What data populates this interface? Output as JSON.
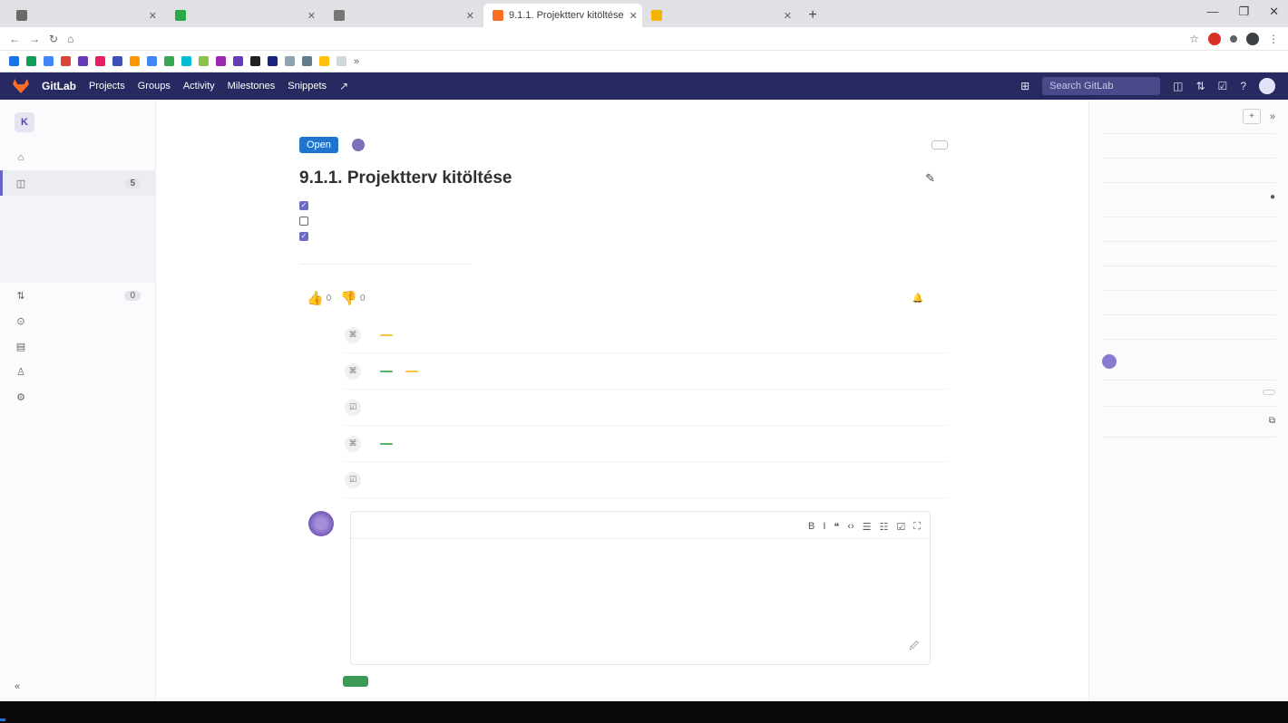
{
  "browser": {
    "tabs": [
      {
        "label": "",
        "color": "#6b6b6b"
      },
      {
        "label": "",
        "color": "#2ba84a"
      },
      {
        "label": "",
        "color": "#777777"
      },
      {
        "label": "9.1.1. Projektterv kitöltése",
        "color": "#fc6d26",
        "active": true
      },
      {
        "label": "",
        "color": "#f4b400"
      }
    ],
    "new_tab": "+",
    "url": "",
    "window_controls": [
      "—",
      "❐",
      "✕"
    ]
  },
  "gitlab_nav": {
    "brand": "GitLab",
    "items": [
      "Projects",
      "Groups",
      "Activity",
      "Milestones",
      "Snippets"
    ],
    "search_placeholder": "Search GitLab"
  },
  "sidebar": {
    "project_initial": "K",
    "project_name": "",
    "items": [
      {
        "icon": "home-icon",
        "glyph": "⌂",
        "label": ""
      },
      {
        "icon": "issues-icon",
        "glyph": "◫",
        "label": "",
        "active": true,
        "count": "5"
      },
      {
        "icon": "merge-request-icon",
        "glyph": "⇅",
        "label": "",
        "count": "0"
      },
      {
        "icon": "ci-icon",
        "glyph": "⊙",
        "label": ""
      },
      {
        "icon": "wiki-icon",
        "glyph": "▤",
        "label": ""
      },
      {
        "icon": "members-icon",
        "glyph": "♙",
        "label": ""
      },
      {
        "icon": "settings-icon",
        "glyph": "⚙",
        "label": ""
      }
    ],
    "sub_items": [
      "",
      "",
      "",
      ""
    ],
    "collapse_label": "",
    "collapse_glyph": "«"
  },
  "main": {
    "breadcrumb": "",
    "status": "Open",
    "opened_text": "",
    "author": "",
    "actions": {
      "close": "",
      "new": ""
    },
    "title": "9.1.1. Projektterv kitöltése",
    "tasks": [
      {
        "checked": true,
        "text": ""
      },
      {
        "checked": false,
        "text": ""
      },
      {
        "checked": true,
        "text": ""
      }
    ],
    "edited_text": "",
    "reactions": [
      {
        "glyph": "👍",
        "count": "0"
      },
      {
        "glyph": "👎",
        "count": "0"
      }
    ],
    "subscribe": "",
    "activity": [
      {
        "user": "",
        "pre": "",
        "label1": "",
        "label1_color": "y",
        "mid": "",
        "label2": "",
        "label2_color": "",
        "post": ""
      },
      {
        "user": "",
        "pre": "",
        "label1": "",
        "label1_color": "g",
        "mid": "",
        "label2": "",
        "label2_color": "y",
        "post": ""
      },
      {
        "user": "",
        "pre": "",
        "label1": "",
        "label1_color": "",
        "mid": "",
        "label2": "",
        "label2_color": "",
        "post": ""
      },
      {
        "user": "",
        "pre": "",
        "label1": "",
        "label1_color": "g",
        "mid": "",
        "label2": "",
        "label2_color": "",
        "post": ""
      },
      {
        "user": "",
        "pre": "",
        "label1": "",
        "label1_color": "",
        "mid": "",
        "label2": "",
        "label2_color": "",
        "post": ""
      }
    ],
    "editor": {
      "tab_write": "",
      "tab_preview": "",
      "placeholder": "",
      "footer_left": "",
      "footer_right": "",
      "tools": [
        "B",
        "I",
        "❝",
        "‹›",
        "☰",
        "☷",
        "☑",
        "⛶"
      ]
    },
    "submit": "",
    "close_issue": ""
  },
  "right_sidebar": {
    "todo": "",
    "collapse": "»",
    "sections": [
      {
        "title": "",
        "edit": "",
        "value": "",
        "dark": false
      },
      {
        "title": "",
        "edit": "",
        "value": "",
        "dark": true
      },
      {
        "title": "",
        "edit": "",
        "value": "",
        "dark": false
      },
      {
        "title": "",
        "edit": "",
        "value": "",
        "dark": false
      },
      {
        "title": "",
        "edit": "",
        "value": "",
        "dark": false
      },
      {
        "title": "",
        "edit": "",
        "value": "",
        "dark": false
      },
      {
        "title": "",
        "edit": "",
        "value": "",
        "dark": false
      },
      {
        "title": "",
        "edit": "",
        "value": "",
        "dark": false
      }
    ],
    "participants_title": "",
    "notifications": "",
    "reference": "",
    "move_issue": ""
  }
}
